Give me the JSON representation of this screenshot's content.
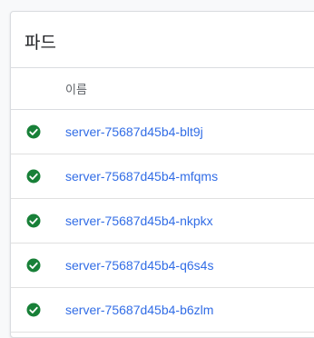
{
  "card": {
    "title": "파드"
  },
  "table": {
    "columns": [
      "이름"
    ],
    "rows": [
      {
        "name": "server-75687d45b4-blt9j",
        "status": "running"
      },
      {
        "name": "server-75687d45b4-mfqms",
        "status": "running"
      },
      {
        "name": "server-75687d45b4-nkpkx",
        "status": "running"
      },
      {
        "name": "server-75687d45b4-q6s4s",
        "status": "running"
      },
      {
        "name": "server-75687d45b4-b6zlm",
        "status": "running"
      }
    ]
  },
  "colors": {
    "status_ok": "#188038",
    "link": "#326de6"
  },
  "icons": {
    "status": "check-circle-icon"
  }
}
